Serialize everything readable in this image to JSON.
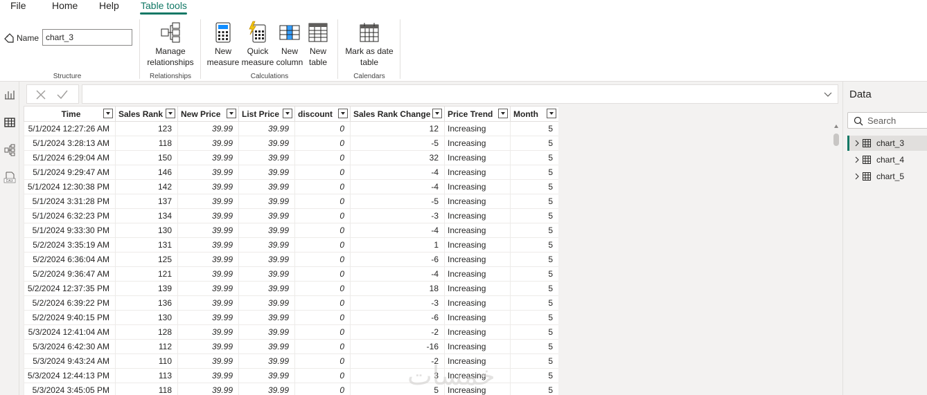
{
  "menu": {
    "items": [
      "File",
      "Home",
      "Help",
      "Table tools"
    ],
    "active": "Table tools"
  },
  "ribbon": {
    "name_label": "Name",
    "name_value": "chart_3",
    "groups": {
      "structure": "Structure",
      "relationships": "Relationships",
      "calculations": "Calculations",
      "calendars": "Calendars"
    },
    "buttons": {
      "manage_relationships": "Manage\nrelationships",
      "new_measure": "New\nmeasure",
      "quick_measure": "Quick\nmeasure",
      "new_column": "New\ncolumn",
      "new_table": "New\ntable",
      "mark_date_table": "Mark as date\ntable"
    }
  },
  "table": {
    "columns": [
      "Time",
      "Sales Rank",
      "New Price",
      "List Price",
      "discount",
      "Sales Rank Change",
      "Price Trend",
      "Month"
    ],
    "rows": [
      [
        "5/1/2024 12:27:26 AM",
        "123",
        "39.99",
        "39.99",
        "0",
        "12",
        "Increasing",
        "5"
      ],
      [
        "5/1/2024 3:28:13 AM",
        "118",
        "39.99",
        "39.99",
        "0",
        "-5",
        "Increasing",
        "5"
      ],
      [
        "5/1/2024 6:29:04 AM",
        "150",
        "39.99",
        "39.99",
        "0",
        "32",
        "Increasing",
        "5"
      ],
      [
        "5/1/2024 9:29:47 AM",
        "146",
        "39.99",
        "39.99",
        "0",
        "-4",
        "Increasing",
        "5"
      ],
      [
        "5/1/2024 12:30:38 PM",
        "142",
        "39.99",
        "39.99",
        "0",
        "-4",
        "Increasing",
        "5"
      ],
      [
        "5/1/2024 3:31:28 PM",
        "137",
        "39.99",
        "39.99",
        "0",
        "-5",
        "Increasing",
        "5"
      ],
      [
        "5/1/2024 6:32:23 PM",
        "134",
        "39.99",
        "39.99",
        "0",
        "-3",
        "Increasing",
        "5"
      ],
      [
        "5/1/2024 9:33:30 PM",
        "130",
        "39.99",
        "39.99",
        "0",
        "-4",
        "Increasing",
        "5"
      ],
      [
        "5/2/2024 3:35:19 AM",
        "131",
        "39.99",
        "39.99",
        "0",
        "1",
        "Increasing",
        "5"
      ],
      [
        "5/2/2024 6:36:04 AM",
        "125",
        "39.99",
        "39.99",
        "0",
        "-6",
        "Increasing",
        "5"
      ],
      [
        "5/2/2024 9:36:47 AM",
        "121",
        "39.99",
        "39.99",
        "0",
        "-4",
        "Increasing",
        "5"
      ],
      [
        "5/2/2024 12:37:35 PM",
        "139",
        "39.99",
        "39.99",
        "0",
        "18",
        "Increasing",
        "5"
      ],
      [
        "5/2/2024 6:39:22 PM",
        "136",
        "39.99",
        "39.99",
        "0",
        "-3",
        "Increasing",
        "5"
      ],
      [
        "5/2/2024 9:40:15 PM",
        "130",
        "39.99",
        "39.99",
        "0",
        "-6",
        "Increasing",
        "5"
      ],
      [
        "5/3/2024 12:41:04 AM",
        "128",
        "39.99",
        "39.99",
        "0",
        "-2",
        "Increasing",
        "5"
      ],
      [
        "5/3/2024 6:42:30 AM",
        "112",
        "39.99",
        "39.99",
        "0",
        "-16",
        "Increasing",
        "5"
      ],
      [
        "5/3/2024 9:43:24 AM",
        "110",
        "39.99",
        "39.99",
        "0",
        "-2",
        "Increasing",
        "5"
      ],
      [
        "5/3/2024 12:44:13 PM",
        "113",
        "39.99",
        "39.99",
        "0",
        "3",
        "Increasing",
        "5"
      ],
      [
        "5/3/2024 3:45:05 PM",
        "118",
        "39.99",
        "39.99",
        "0",
        "5",
        "Increasing",
        "5"
      ]
    ]
  },
  "data_pane": {
    "title": "Data",
    "search_placeholder": "Search",
    "tables": [
      "chart_3",
      "chart_4",
      "chart_5"
    ],
    "selected": "chart_3"
  },
  "watermark": "خمسات",
  "colors": {
    "accent": "#117865"
  }
}
